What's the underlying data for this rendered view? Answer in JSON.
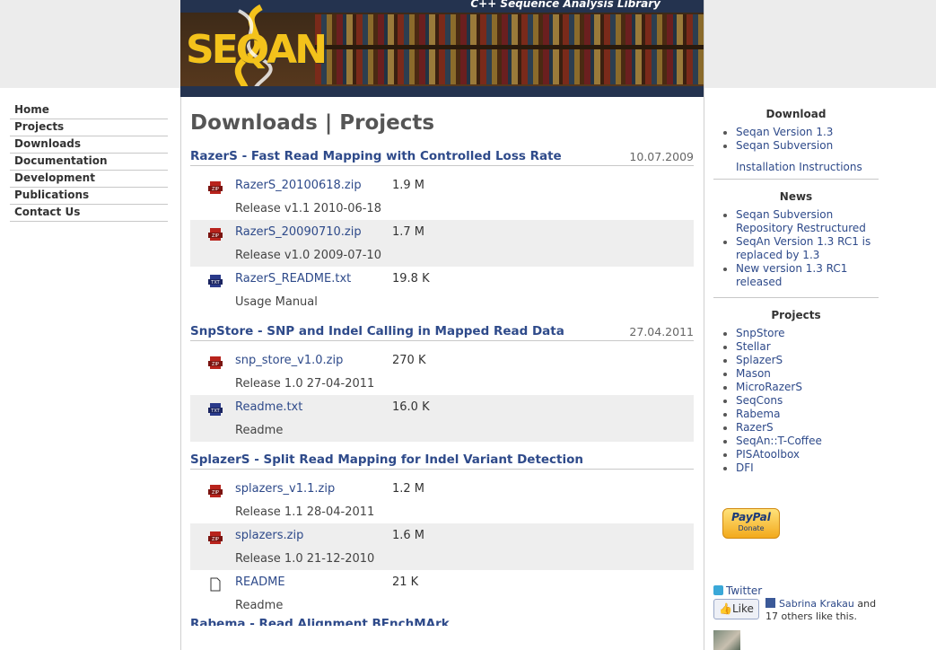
{
  "banner": {
    "tagline": "C++ Sequence Analysis Library",
    "logo": "SEQAN"
  },
  "nav": {
    "items": [
      "Home",
      "Projects",
      "Downloads",
      "Documentation",
      "Development",
      "Publications",
      "Contact Us"
    ]
  },
  "page": {
    "title": "Downloads | Projects"
  },
  "sections": [
    {
      "title": "RazerS - Fast Read Mapping with Controlled Loss Rate",
      "date": "10.07.2009",
      "files": [
        {
          "icon": "zip-file-icon",
          "name": "RazerS_20100618.zip",
          "size": "1.9 M",
          "desc": "Release v1.1 2010-06-18"
        },
        {
          "icon": "zip-file-icon",
          "name": "RazerS_20090710.zip",
          "size": "1.7 M",
          "desc": "Release v1.0 2009-07-10"
        },
        {
          "icon": "text-file-icon",
          "name": "RazerS_README.txt",
          "size": "19.8 K",
          "desc": "Usage Manual"
        }
      ]
    },
    {
      "title": "SnpStore - SNP and Indel Calling in Mapped Read Data",
      "date": "27.04.2011",
      "files": [
        {
          "icon": "zip-file-icon",
          "name": "snp_store_v1.0.zip",
          "size": "270 K",
          "desc": "Release 1.0 27-04-2011"
        },
        {
          "icon": "text-file-icon",
          "name": "Readme.txt",
          "size": "16.0 K",
          "desc": "Readme"
        }
      ]
    },
    {
      "title": "SplazerS - Split Read Mapping for Indel Variant Detection",
      "date": "",
      "files": [
        {
          "icon": "zip-file-icon",
          "name": "splazers_v1.1.zip",
          "size": "1.2 M",
          "desc": "Release 1.1 28-04-2011"
        },
        {
          "icon": "zip-file-icon",
          "name": "splazers.zip",
          "size": "1.6 M",
          "desc": "Release 1.0 21-12-2010"
        },
        {
          "icon": "blank-file-icon",
          "name": "README",
          "size": "21 K",
          "desc": "Readme"
        }
      ]
    }
  ],
  "cutoff_heading": "Rabema - Read Alignment BEnchMArk",
  "sidebar": {
    "download": {
      "heading": "Download",
      "items": [
        "Seqan Version 1.3",
        "Seqan Subversion"
      ],
      "extra": "Installation Instructions"
    },
    "news": {
      "heading": "News",
      "items": [
        "Seqan Subversion Repository Restructured",
        "SeqAn Version 1.3 RC1 is replaced by 1.3",
        "New version 1.3 RC1 released"
      ]
    },
    "projects": {
      "heading": "Projects",
      "items": [
        "SnpStore",
        "Stellar",
        "SplazerS",
        "Mason",
        "MicroRazerS",
        "SeqCons",
        "Rabema",
        "RazerS",
        "SeqAn::T-Coffee",
        "PISAtoolbox",
        "DFI"
      ]
    }
  },
  "paypal": {
    "brand": "PayPal",
    "label": "Donate"
  },
  "social": {
    "twitter": "Twitter",
    "like": "Like",
    "fb_name": "Sabrina Krakau",
    "fb_rest": " and 17 others like this."
  },
  "colors": {
    "link": "#2e4a8a",
    "banner_blue": "#24334f",
    "logo_yellow": "#f3c21b"
  }
}
